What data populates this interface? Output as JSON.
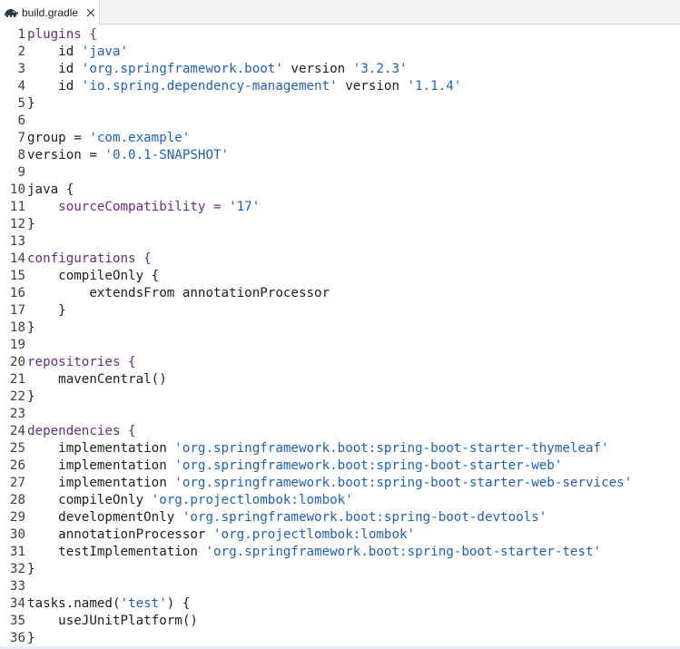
{
  "tab": {
    "label": "build.gradle",
    "icon": "gradle-elephant-icon"
  },
  "lines": [
    {
      "n": "1",
      "parts": [
        {
          "t": "plugins {",
          "c": "kw"
        }
      ]
    },
    {
      "n": "2",
      "parts": [
        {
          "t": "    id ",
          "c": ""
        },
        {
          "t": "'java'",
          "c": "str"
        }
      ]
    },
    {
      "n": "3",
      "parts": [
        {
          "t": "    id ",
          "c": ""
        },
        {
          "t": "'org.springframework.boot'",
          "c": "str"
        },
        {
          "t": " version ",
          "c": ""
        },
        {
          "t": "'3.2.3'",
          "c": "str"
        }
      ]
    },
    {
      "n": "4",
      "parts": [
        {
          "t": "    id ",
          "c": ""
        },
        {
          "t": "'io.spring.dependency-management'",
          "c": "str"
        },
        {
          "t": " version ",
          "c": ""
        },
        {
          "t": "'1.1.4'",
          "c": "str"
        }
      ]
    },
    {
      "n": "5",
      "parts": [
        {
          "t": "}",
          "c": ""
        }
      ]
    },
    {
      "n": "6",
      "parts": []
    },
    {
      "n": "7",
      "parts": [
        {
          "t": "group = ",
          "c": ""
        },
        {
          "t": "'com.example'",
          "c": "str"
        }
      ]
    },
    {
      "n": "8",
      "parts": [
        {
          "t": "version = ",
          "c": ""
        },
        {
          "t": "'0.0.1-SNAPSHOT'",
          "c": "str"
        }
      ]
    },
    {
      "n": "9",
      "parts": []
    },
    {
      "n": "10",
      "parts": [
        {
          "t": "java {",
          "c": ""
        }
      ]
    },
    {
      "n": "11",
      "parts": [
        {
          "t": "    ",
          "c": ""
        },
        {
          "t": "sourceCompatibility = ",
          "c": "kw"
        },
        {
          "t": "'17'",
          "c": "str"
        }
      ]
    },
    {
      "n": "12",
      "parts": [
        {
          "t": "}",
          "c": ""
        }
      ]
    },
    {
      "n": "13",
      "parts": []
    },
    {
      "n": "14",
      "parts": [
        {
          "t": "configurations {",
          "c": "kw"
        }
      ]
    },
    {
      "n": "15",
      "parts": [
        {
          "t": "    compileOnly {",
          "c": ""
        }
      ]
    },
    {
      "n": "16",
      "parts": [
        {
          "t": "        extendsFrom annotationProcessor",
          "c": ""
        }
      ]
    },
    {
      "n": "17",
      "parts": [
        {
          "t": "    }",
          "c": ""
        }
      ]
    },
    {
      "n": "18",
      "parts": [
        {
          "t": "}",
          "c": ""
        }
      ]
    },
    {
      "n": "19",
      "parts": []
    },
    {
      "n": "20",
      "parts": [
        {
          "t": "repositories {",
          "c": "kw"
        }
      ]
    },
    {
      "n": "21",
      "parts": [
        {
          "t": "    mavenCentral()",
          "c": ""
        }
      ]
    },
    {
      "n": "22",
      "parts": [
        {
          "t": "}",
          "c": ""
        }
      ]
    },
    {
      "n": "23",
      "parts": []
    },
    {
      "n": "24",
      "parts": [
        {
          "t": "dependencies {",
          "c": "kw"
        }
      ]
    },
    {
      "n": "25",
      "parts": [
        {
          "t": "    implementation ",
          "c": ""
        },
        {
          "t": "'org.springframework.boot:spring-boot-starter-thymeleaf'",
          "c": "str"
        }
      ]
    },
    {
      "n": "26",
      "parts": [
        {
          "t": "    implementation ",
          "c": ""
        },
        {
          "t": "'org.springframework.boot:spring-boot-starter-web'",
          "c": "str"
        }
      ]
    },
    {
      "n": "27",
      "parts": [
        {
          "t": "    implementation ",
          "c": ""
        },
        {
          "t": "'org.springframework.boot:spring-boot-starter-web-services'",
          "c": "str"
        }
      ]
    },
    {
      "n": "28",
      "parts": [
        {
          "t": "    compileOnly ",
          "c": ""
        },
        {
          "t": "'org.projectlombok:lombok'",
          "c": "str"
        }
      ]
    },
    {
      "n": "29",
      "parts": [
        {
          "t": "    developmentOnly ",
          "c": ""
        },
        {
          "t": "'org.springframework.boot:spring-boot-devtools'",
          "c": "str"
        }
      ]
    },
    {
      "n": "30",
      "parts": [
        {
          "t": "    annotationProcessor ",
          "c": ""
        },
        {
          "t": "'org.projectlombok:lombok'",
          "c": "str"
        }
      ]
    },
    {
      "n": "31",
      "parts": [
        {
          "t": "    testImplementation ",
          "c": ""
        },
        {
          "t": "'org.springframework.boot:spring-boot-starter-test'",
          "c": "str"
        }
      ]
    },
    {
      "n": "32",
      "parts": [
        {
          "t": "}",
          "c": ""
        }
      ]
    },
    {
      "n": "33",
      "parts": []
    },
    {
      "n": "34",
      "parts": [
        {
          "t": "tasks.named(",
          "c": ""
        },
        {
          "t": "'test'",
          "c": "str"
        },
        {
          "t": ") {",
          "c": ""
        }
      ]
    },
    {
      "n": "35",
      "parts": [
        {
          "t": "    useJUnitPlatform()",
          "c": ""
        }
      ]
    },
    {
      "n": "36",
      "parts": [
        {
          "t": "}",
          "c": ""
        }
      ]
    }
  ]
}
